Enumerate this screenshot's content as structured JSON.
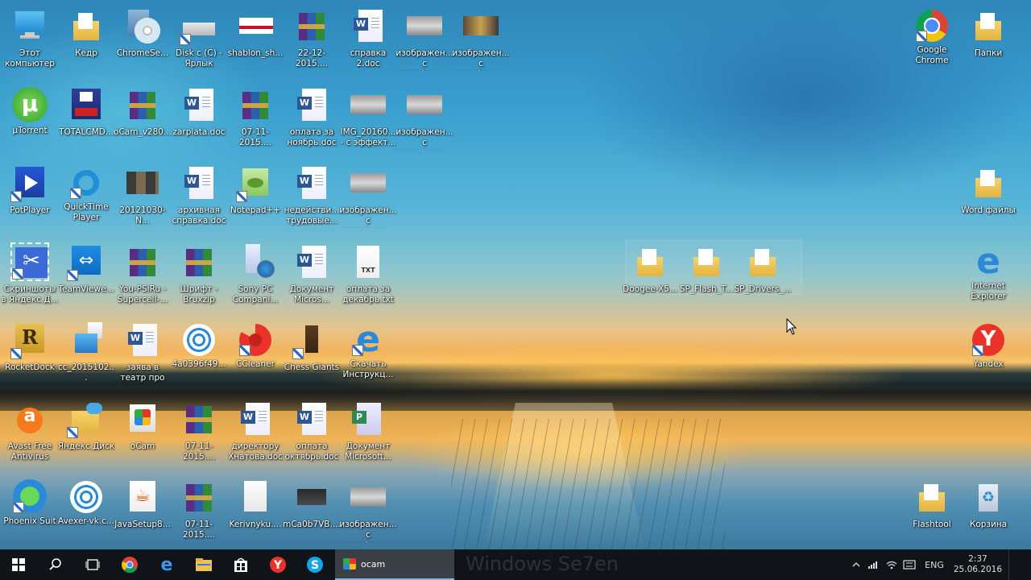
{
  "desktop": {
    "icons": [
      {
        "label": "Этот компьютер",
        "type": "t-computer",
        "shortcut": false,
        "col": 0,
        "row": 0
      },
      {
        "label": "Кедр",
        "type": "t-folder-paper",
        "shortcut": false,
        "col": 1,
        "row": 0
      },
      {
        "label": "ChromeSe...",
        "type": "t-disc",
        "shortcut": false,
        "col": 2,
        "row": 0
      },
      {
        "label": "Disk c (C) - Ярлык",
        "type": "t-drive",
        "shortcut": true,
        "col": 3,
        "row": 0
      },
      {
        "label": "shablon_sh...",
        "type": "t-flag",
        "shortcut": false,
        "col": 4,
        "row": 0
      },
      {
        "label": "22-12-2015....",
        "type": "t-rar",
        "shortcut": false,
        "col": 5,
        "row": 0
      },
      {
        "label": "справка 2.doc",
        "type": "t-word",
        "shortcut": false,
        "col": 6,
        "row": 0
      },
      {
        "label": "изображен... с телефона...",
        "type": "t-photo",
        "shortcut": false,
        "col": 7,
        "row": 0
      },
      {
        "label": "изображен... с телефона...",
        "type": "t-photo2",
        "shortcut": false,
        "col": 8,
        "row": 0
      },
      {
        "label": "µTorrent",
        "type": "t-utorrent",
        "shortcut": false,
        "col": 0,
        "row": 1
      },
      {
        "label": "TOTALCMD...",
        "type": "t-floppy",
        "shortcut": false,
        "col": 1,
        "row": 1
      },
      {
        "label": "oCam_v280...",
        "type": "t-rar",
        "shortcut": false,
        "col": 2,
        "row": 1
      },
      {
        "label": "zarplata.doc",
        "type": "t-word",
        "shortcut": false,
        "col": 3,
        "row": 1
      },
      {
        "label": "07-11-2015....",
        "type": "t-rar",
        "shortcut": false,
        "col": 4,
        "row": 1
      },
      {
        "label": "оплата за ноябрь.doc",
        "type": "t-word",
        "shortcut": false,
        "col": 5,
        "row": 1
      },
      {
        "label": "IMG_20160... - с эффект...",
        "type": "t-photo",
        "shortcut": false,
        "col": 6,
        "row": 1
      },
      {
        "label": "изображен... с телефона...",
        "type": "t-photo",
        "shortcut": false,
        "col": 7,
        "row": 1
      },
      {
        "label": "PotPlayer",
        "type": "t-potplayer",
        "shortcut": true,
        "col": 0,
        "row": 2
      },
      {
        "label": "QuickTime Player",
        "type": "t-quicktime",
        "shortcut": true,
        "col": 1,
        "row": 2
      },
      {
        "label": "20121030-N...",
        "type": "t-film",
        "shortcut": false,
        "col": 2,
        "row": 2
      },
      {
        "label": "архивная справка.doc",
        "type": "t-word",
        "shortcut": false,
        "col": 3,
        "row": 2
      },
      {
        "label": "Notepad++",
        "type": "t-notepad",
        "shortcut": true,
        "col": 4,
        "row": 2
      },
      {
        "label": "недействи... трудовые...",
        "type": "t-word",
        "shortcut": false,
        "col": 5,
        "row": 2
      },
      {
        "label": "изображен... с телефона...",
        "type": "t-photo",
        "shortcut": false,
        "col": 6,
        "row": 2
      },
      {
        "label": "Скриншоты в Яндекс.Д...",
        "type": "t-scissors",
        "shortcut": true,
        "col": 0,
        "row": 3
      },
      {
        "label": "TeamViewe...",
        "type": "t-teamviewer",
        "shortcut": true,
        "col": 1,
        "row": 3
      },
      {
        "label": "You-PSiRu - Supercell-...",
        "type": "t-rar",
        "shortcut": false,
        "col": 2,
        "row": 3
      },
      {
        "label": "Шрифт - Bruxzip",
        "type": "t-rar",
        "shortcut": false,
        "col": 3,
        "row": 3
      },
      {
        "label": "Sony PC Compani...",
        "type": "t-phone",
        "shortcut": true,
        "col": 4,
        "row": 3
      },
      {
        "label": "Документ Micros...",
        "type": "t-word",
        "shortcut": false,
        "col": 5,
        "row": 3
      },
      {
        "label": "оплата за декабрь.txt",
        "type": "t-txt",
        "shortcut": false,
        "col": 6,
        "row": 3
      },
      {
        "label": "RocketDock",
        "type": "t-rocket",
        "shortcut": true,
        "col": 0,
        "row": 4
      },
      {
        "label": "cc_2015102...",
        "type": "t-cubes",
        "shortcut": false,
        "col": 1,
        "row": 4
      },
      {
        "label": "заява в театр про архив...",
        "type": "t-word",
        "shortcut": false,
        "col": 2,
        "row": 4
      },
      {
        "label": "4a0396f49...",
        "type": "t-target",
        "shortcut": false,
        "col": 3,
        "row": 4
      },
      {
        "label": "CCleaner",
        "type": "t-ccleaner",
        "shortcut": true,
        "col": 4,
        "row": 4
      },
      {
        "label": "Chess Giants",
        "type": "t-chess",
        "shortcut": true,
        "col": 5,
        "row": 4
      },
      {
        "label": "Скачать Инструкц...",
        "type": "t-ie",
        "shortcut": true,
        "col": 6,
        "row": 4
      },
      {
        "label": "Avast Free Antivirus",
        "type": "t-avast",
        "shortcut": false,
        "col": 0,
        "row": 5
      },
      {
        "label": "Яндекс.Диск",
        "type": "t-yadisk",
        "shortcut": true,
        "col": 1,
        "row": 5
      },
      {
        "label": "oCam",
        "type": "t-ocam",
        "shortcut": false,
        "col": 2,
        "row": 5
      },
      {
        "label": "07-11-2015....",
        "type": "t-rar",
        "shortcut": false,
        "col": 3,
        "row": 5
      },
      {
        "label": "директору Хнатова.doc",
        "type": "t-word",
        "shortcut": false,
        "col": 4,
        "row": 5
      },
      {
        "label": "оплата октябрь.doc",
        "type": "t-word",
        "shortcut": false,
        "col": 5,
        "row": 5
      },
      {
        "label": "Документ Microsoft...",
        "type": "t-visio",
        "shortcut": false,
        "col": 6,
        "row": 5
      },
      {
        "label": "Phoenix Suit",
        "type": "t-phoenix",
        "shortcut": true,
        "col": 0,
        "row": 6
      },
      {
        "label": "Avexer-vk.c...",
        "type": "t-target",
        "shortcut": false,
        "col": 1,
        "row": 6
      },
      {
        "label": "JavaSetup8...",
        "type": "t-java",
        "shortcut": false,
        "col": 2,
        "row": 6
      },
      {
        "label": "07-11-2015....",
        "type": "t-rar",
        "shortcut": false,
        "col": 3,
        "row": 6
      },
      {
        "label": "Kerivnyku....",
        "type": "t-blank",
        "shortcut": false,
        "col": 4,
        "row": 6
      },
      {
        "label": "mCa0b7VB....",
        "type": "t-cam",
        "shortcut": false,
        "col": 5,
        "row": 6
      },
      {
        "label": "изображен... с телефона...",
        "type": "t-photo",
        "shortcut": false,
        "col": 6,
        "row": 6
      },
      {
        "label": "Google Chrome",
        "type": "t-chrome",
        "shortcut": true,
        "col": 16,
        "row": 0
      },
      {
        "label": "Папки",
        "type": "t-folder-paper",
        "shortcut": false,
        "col": 17,
        "row": 0
      },
      {
        "label": "Word файлы",
        "type": "t-folder-paper",
        "shortcut": false,
        "col": 17,
        "row": 2
      },
      {
        "label": "Internet Explorer",
        "type": "t-ie",
        "shortcut": false,
        "col": 17,
        "row": 3
      },
      {
        "label": "Yandex",
        "type": "t-yandex",
        "shortcut": true,
        "col": 17,
        "row": 4
      },
      {
        "label": "Flashtool",
        "type": "t-folder-paper",
        "shortcut": false,
        "col": 16,
        "row": 6
      },
      {
        "label": "Корзина",
        "type": "t-recycle",
        "shortcut": false,
        "col": 17,
        "row": 6
      }
    ],
    "floating_icons": [
      {
        "label": "Doogee-X5...",
        "type": "t-folder-paper",
        "col": 11,
        "row": 3
      },
      {
        "label": "SP_Flash_T...",
        "type": "t-folder-paper",
        "col": 12,
        "row": 3
      },
      {
        "label": "SP_Drivers_...",
        "type": "t-folder-paper",
        "col": 13,
        "row": 3
      }
    ]
  },
  "taskbar": {
    "start_icon": "windows-start-icon",
    "search_icon": "search-icon",
    "task_view_icon": "task-view-icon",
    "pinned": [
      {
        "name": "chrome-taskbar-icon"
      },
      {
        "name": "edge-taskbar-icon"
      },
      {
        "name": "explorer-taskbar-icon"
      },
      {
        "name": "store-taskbar-icon"
      },
      {
        "name": "yandex-taskbar-icon"
      },
      {
        "name": "skype-taskbar-icon"
      }
    ],
    "active_window_label": "ocam",
    "watermark": "Windows Se7en",
    "tray": {
      "language": "ENG",
      "time": "2:37",
      "date": "25.06.2016"
    }
  }
}
